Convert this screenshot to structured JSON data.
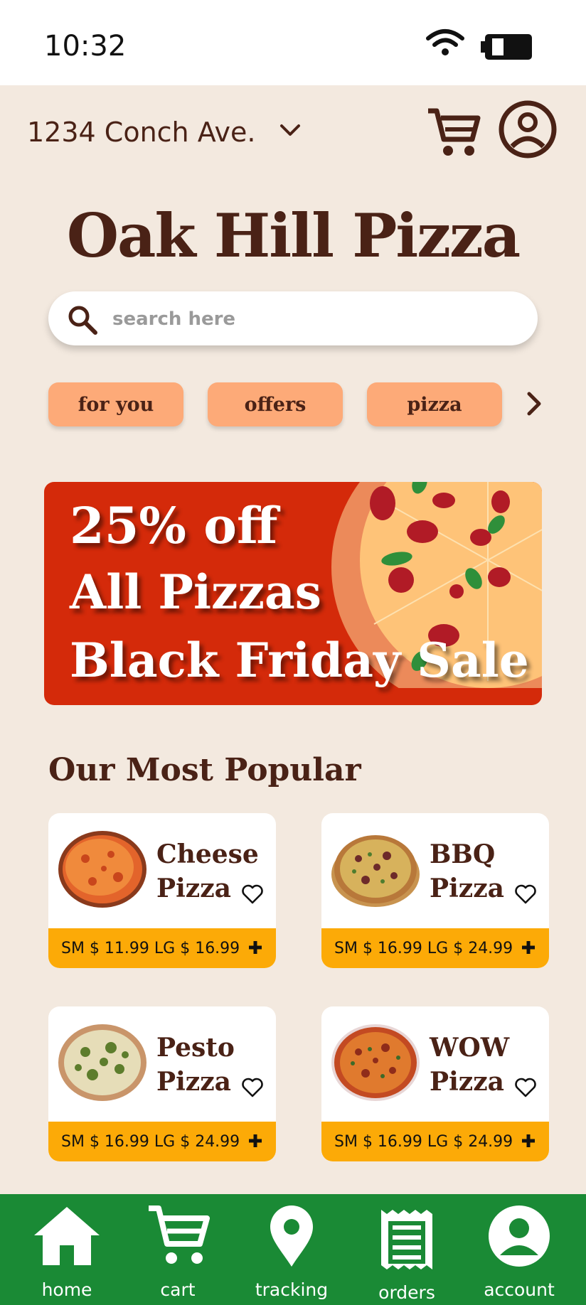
{
  "status_bar": {
    "time": "10:32"
  },
  "header": {
    "address": "1234 Conch Ave."
  },
  "title": "Oak Hill Pizza",
  "search": {
    "placeholder": "search here"
  },
  "chips": [
    "for you",
    "offers",
    "pizza"
  ],
  "banner": {
    "line1": "25% off",
    "line2": "All Pizzas",
    "line3": "Black Friday Sale"
  },
  "section_title": "Our Most Popular",
  "products": [
    {
      "name": "Cheese Pizza",
      "prices": "SM $ 11.99  LG $ 16.99"
    },
    {
      "name": "BBQ Pizza",
      "prices": "SM $ 16.99  LG $ 24.99"
    },
    {
      "name": "Pesto Pizza",
      "prices": "SM $ 16.99  LG $ 24.99"
    },
    {
      "name": "WOW Pizza",
      "prices": "SM $ 16.99  LG $ 24.99"
    }
  ],
  "bottom_nav": [
    {
      "label": "home",
      "icon": "home-icon"
    },
    {
      "label": "cart",
      "icon": "cart-icon"
    },
    {
      "label": "tracking",
      "icon": "location-pin-icon"
    },
    {
      "label": "orders",
      "icon": "receipt-icon"
    },
    {
      "label": "account",
      "icon": "account-icon"
    }
  ],
  "colors": {
    "background": "#f3e9df",
    "brown": "#4a2216",
    "chip": "#fdaa78",
    "banner": "#d42a0a",
    "price_bar": "#fcaa07",
    "nav": "#1a8a35"
  }
}
